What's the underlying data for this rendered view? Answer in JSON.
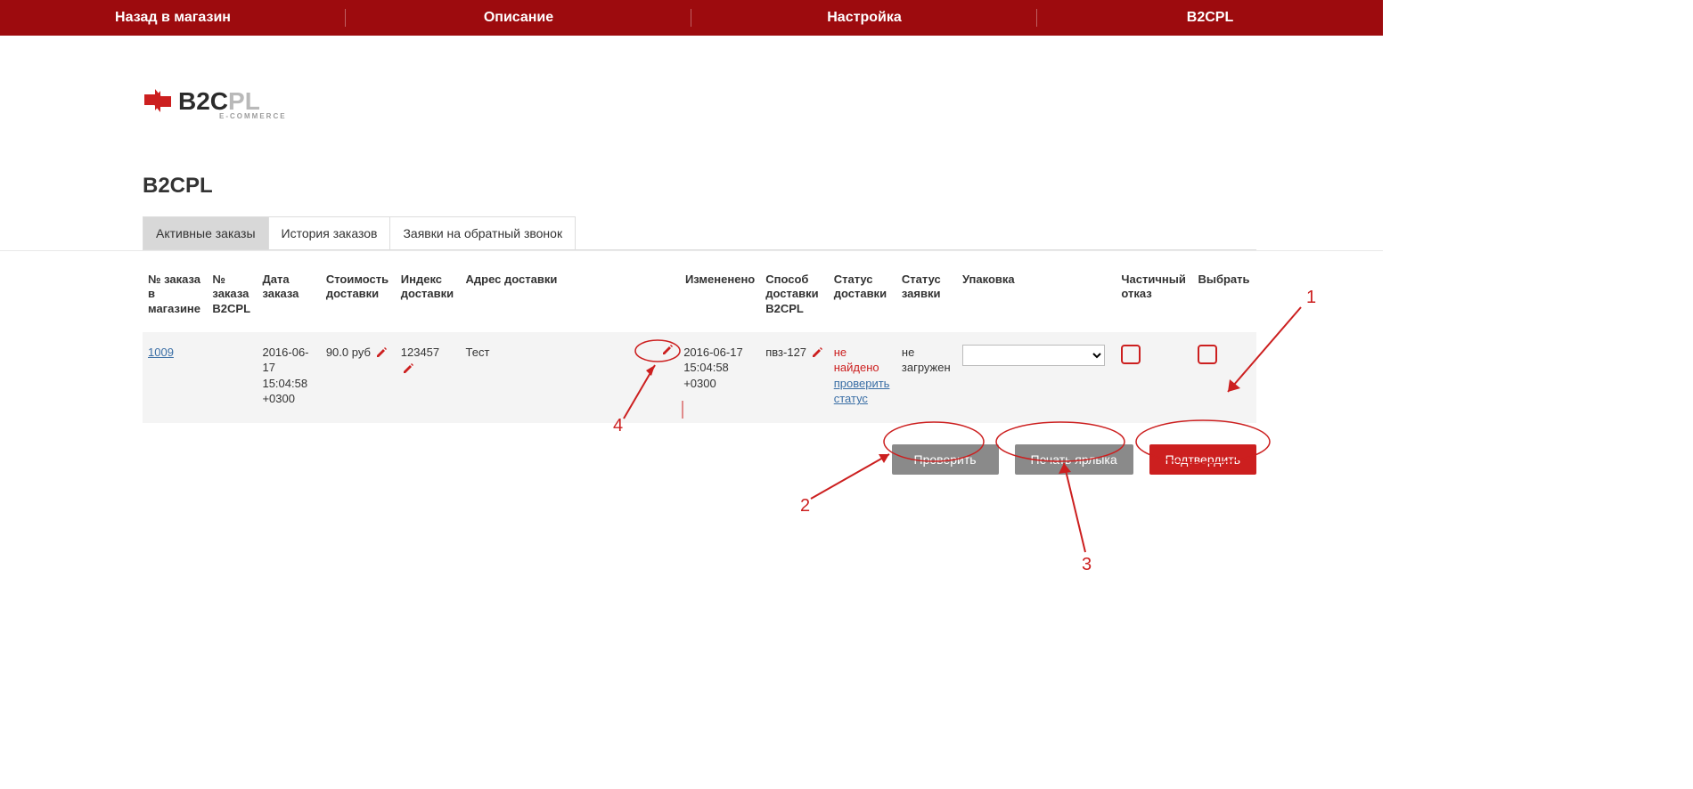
{
  "nav": {
    "items": [
      "Назад в магазин",
      "Описание",
      "Настройка",
      "B2CPL"
    ]
  },
  "logo": {
    "b2c": "B2C",
    "pl": "PL",
    "ecom": "E-COMMERCE"
  },
  "page_title": "B2CPL",
  "tabs": [
    {
      "label": "Активные заказы",
      "active": true
    },
    {
      "label": "История заказов",
      "active": false
    },
    {
      "label": "Заявки на обратный звонок",
      "active": false
    }
  ],
  "table": {
    "columns": [
      "№ заказа в магазине",
      "№ заказа B2CPL",
      "Дата заказа",
      "Стоимость доставки",
      "Индекс доставки",
      "Адрес доставки",
      "Измененено",
      "Способ доставки B2CPL",
      "Статус доставки",
      "Статус заявки",
      "Упаковка",
      "Частичный отказ",
      "Выбрать"
    ],
    "rows": [
      {
        "order_shop": "1009",
        "order_b2cpl": "",
        "date": "2016-06-17 15:04:58 +0300",
        "cost": "90.0 руб",
        "index": "123457",
        "address": "Тест",
        "changed": "2016-06-17 15:04:58 +0300",
        "method": "пвз-127",
        "status_delivery": {
          "text": "не найдено",
          "link": "проверить статус"
        },
        "status_request": "не загружен",
        "packaging": "",
        "partial_refuse": false,
        "select": false
      }
    ]
  },
  "actions": {
    "check": "Проверить",
    "print": "Печать ярлыка",
    "confirm": "Подтвердить"
  },
  "annotations": {
    "n1": "1",
    "n2": "2",
    "n3": "3",
    "n4": "4"
  }
}
